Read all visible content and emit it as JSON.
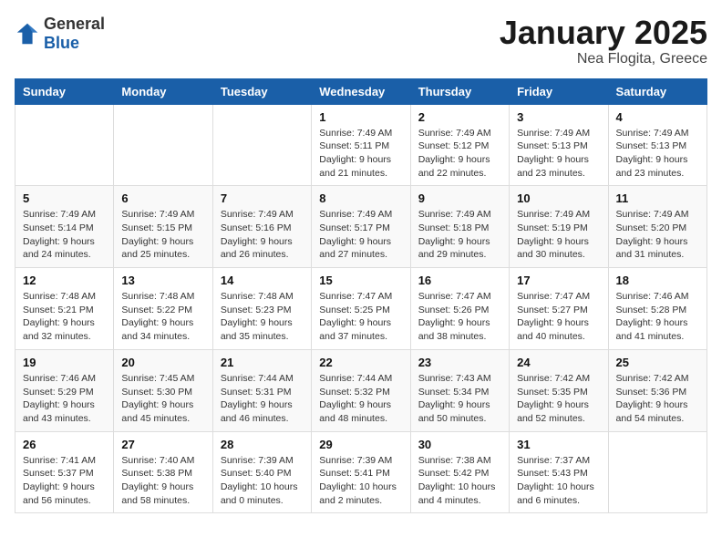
{
  "logo": {
    "general": "General",
    "blue": "Blue"
  },
  "header": {
    "month": "January 2025",
    "location": "Nea Flogita, Greece"
  },
  "weekdays": [
    "Sunday",
    "Monday",
    "Tuesday",
    "Wednesday",
    "Thursday",
    "Friday",
    "Saturday"
  ],
  "weeks": [
    [
      {
        "day": "",
        "info": ""
      },
      {
        "day": "",
        "info": ""
      },
      {
        "day": "",
        "info": ""
      },
      {
        "day": "1",
        "info": "Sunrise: 7:49 AM\nSunset: 5:11 PM\nDaylight: 9 hours and 21 minutes."
      },
      {
        "day": "2",
        "info": "Sunrise: 7:49 AM\nSunset: 5:12 PM\nDaylight: 9 hours and 22 minutes."
      },
      {
        "day": "3",
        "info": "Sunrise: 7:49 AM\nSunset: 5:13 PM\nDaylight: 9 hours and 23 minutes."
      },
      {
        "day": "4",
        "info": "Sunrise: 7:49 AM\nSunset: 5:13 PM\nDaylight: 9 hours and 23 minutes."
      }
    ],
    [
      {
        "day": "5",
        "info": "Sunrise: 7:49 AM\nSunset: 5:14 PM\nDaylight: 9 hours and 24 minutes."
      },
      {
        "day": "6",
        "info": "Sunrise: 7:49 AM\nSunset: 5:15 PM\nDaylight: 9 hours and 25 minutes."
      },
      {
        "day": "7",
        "info": "Sunrise: 7:49 AM\nSunset: 5:16 PM\nDaylight: 9 hours and 26 minutes."
      },
      {
        "day": "8",
        "info": "Sunrise: 7:49 AM\nSunset: 5:17 PM\nDaylight: 9 hours and 27 minutes."
      },
      {
        "day": "9",
        "info": "Sunrise: 7:49 AM\nSunset: 5:18 PM\nDaylight: 9 hours and 29 minutes."
      },
      {
        "day": "10",
        "info": "Sunrise: 7:49 AM\nSunset: 5:19 PM\nDaylight: 9 hours and 30 minutes."
      },
      {
        "day": "11",
        "info": "Sunrise: 7:49 AM\nSunset: 5:20 PM\nDaylight: 9 hours and 31 minutes."
      }
    ],
    [
      {
        "day": "12",
        "info": "Sunrise: 7:48 AM\nSunset: 5:21 PM\nDaylight: 9 hours and 32 minutes."
      },
      {
        "day": "13",
        "info": "Sunrise: 7:48 AM\nSunset: 5:22 PM\nDaylight: 9 hours and 34 minutes."
      },
      {
        "day": "14",
        "info": "Sunrise: 7:48 AM\nSunset: 5:23 PM\nDaylight: 9 hours and 35 minutes."
      },
      {
        "day": "15",
        "info": "Sunrise: 7:47 AM\nSunset: 5:25 PM\nDaylight: 9 hours and 37 minutes."
      },
      {
        "day": "16",
        "info": "Sunrise: 7:47 AM\nSunset: 5:26 PM\nDaylight: 9 hours and 38 minutes."
      },
      {
        "day": "17",
        "info": "Sunrise: 7:47 AM\nSunset: 5:27 PM\nDaylight: 9 hours and 40 minutes."
      },
      {
        "day": "18",
        "info": "Sunrise: 7:46 AM\nSunset: 5:28 PM\nDaylight: 9 hours and 41 minutes."
      }
    ],
    [
      {
        "day": "19",
        "info": "Sunrise: 7:46 AM\nSunset: 5:29 PM\nDaylight: 9 hours and 43 minutes."
      },
      {
        "day": "20",
        "info": "Sunrise: 7:45 AM\nSunset: 5:30 PM\nDaylight: 9 hours and 45 minutes."
      },
      {
        "day": "21",
        "info": "Sunrise: 7:44 AM\nSunset: 5:31 PM\nDaylight: 9 hours and 46 minutes."
      },
      {
        "day": "22",
        "info": "Sunrise: 7:44 AM\nSunset: 5:32 PM\nDaylight: 9 hours and 48 minutes."
      },
      {
        "day": "23",
        "info": "Sunrise: 7:43 AM\nSunset: 5:34 PM\nDaylight: 9 hours and 50 minutes."
      },
      {
        "day": "24",
        "info": "Sunrise: 7:42 AM\nSunset: 5:35 PM\nDaylight: 9 hours and 52 minutes."
      },
      {
        "day": "25",
        "info": "Sunrise: 7:42 AM\nSunset: 5:36 PM\nDaylight: 9 hours and 54 minutes."
      }
    ],
    [
      {
        "day": "26",
        "info": "Sunrise: 7:41 AM\nSunset: 5:37 PM\nDaylight: 9 hours and 56 minutes."
      },
      {
        "day": "27",
        "info": "Sunrise: 7:40 AM\nSunset: 5:38 PM\nDaylight: 9 hours and 58 minutes."
      },
      {
        "day": "28",
        "info": "Sunrise: 7:39 AM\nSunset: 5:40 PM\nDaylight: 10 hours and 0 minutes."
      },
      {
        "day": "29",
        "info": "Sunrise: 7:39 AM\nSunset: 5:41 PM\nDaylight: 10 hours and 2 minutes."
      },
      {
        "day": "30",
        "info": "Sunrise: 7:38 AM\nSunset: 5:42 PM\nDaylight: 10 hours and 4 minutes."
      },
      {
        "day": "31",
        "info": "Sunrise: 7:37 AM\nSunset: 5:43 PM\nDaylight: 10 hours and 6 minutes."
      },
      {
        "day": "",
        "info": ""
      }
    ]
  ]
}
